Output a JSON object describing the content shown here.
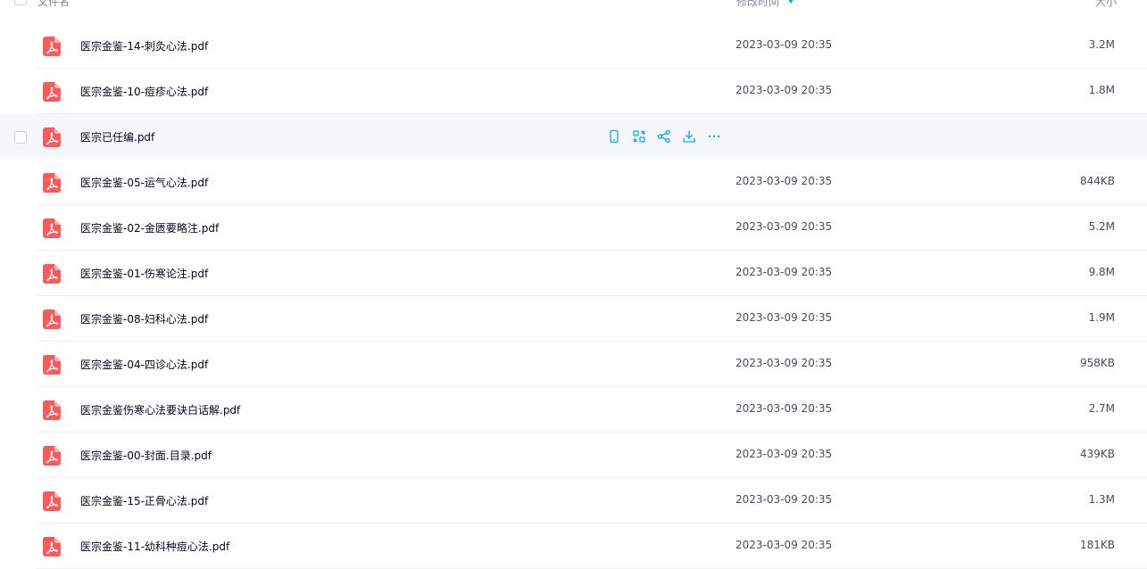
{
  "header": {
    "name_label": "文件名",
    "time_label": "修改时间",
    "size_label": "大小"
  },
  "colors": {
    "pdf_icon": "#fa5a5a",
    "accent": "#06a7ff",
    "hover_row": "#f5f7fc"
  },
  "files": [
    {
      "name": "医宗金鉴-14-刺灸心法.pdf",
      "time": "2023-03-09 20:35",
      "size": "3.2M"
    },
    {
      "name": "医宗金鉴-10-痘疹心法.pdf",
      "time": "2023-03-09 20:35",
      "size": "1.8M"
    },
    {
      "name": "医宗已任编.pdf",
      "time": "",
      "size": ""
    },
    {
      "name": "医宗金鉴-05-运气心法.pdf",
      "time": "2023-03-09 20:35",
      "size": "844KB"
    },
    {
      "name": "医宗金鉴-02-金匮要略注.pdf",
      "time": "2023-03-09 20:35",
      "size": "5.2M"
    },
    {
      "name": "医宗金鉴-01-伤寒论注.pdf",
      "time": "2023-03-09 20:35",
      "size": "9.8M"
    },
    {
      "name": "医宗金鉴-08-妇科心法.pdf",
      "time": "2023-03-09 20:35",
      "size": "1.9M"
    },
    {
      "name": "医宗金鉴-04-四诊心法.pdf",
      "time": "2023-03-09 20:35",
      "size": "958KB"
    },
    {
      "name": "医宗金鉴伤寒心法要诀白话解.pdf",
      "time": "2023-03-09 20:35",
      "size": "2.7M"
    },
    {
      "name": "医宗金鉴-00-封面.目录.pdf",
      "time": "2023-03-09 20:35",
      "size": "439KB"
    },
    {
      "name": "医宗金鉴-15-正骨心法.pdf",
      "time": "2023-03-09 20:35",
      "size": "1.3M"
    },
    {
      "name": "医宗金鉴-11-幼科种痘心法.pdf",
      "time": "2023-03-09 20:35",
      "size": "181KB"
    }
  ],
  "hover_actions": [
    "phone-icon",
    "transfer-icon",
    "share-icon",
    "download-icon",
    "more-icon"
  ]
}
